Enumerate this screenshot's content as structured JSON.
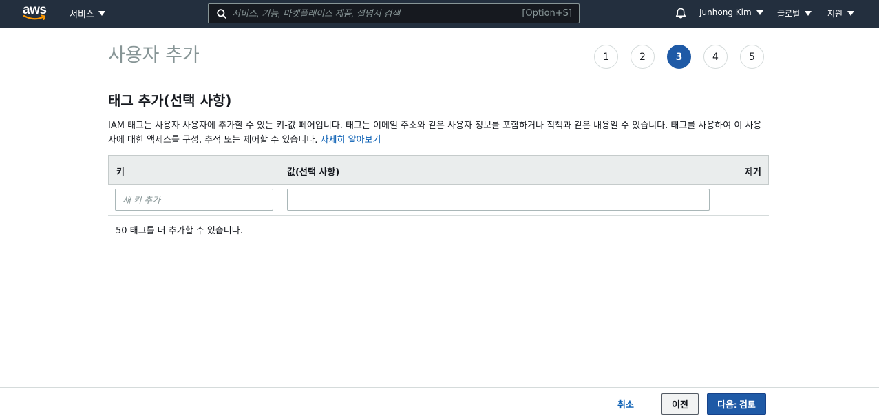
{
  "nav": {
    "logo_text": "aws",
    "services_label": "서비스",
    "search_placeholder": "서비스, 기능, 마켓플레이스 제품, 설명서 검색",
    "search_shortcut": "[Option+S]",
    "user_label": "Junhong Kim",
    "region_label": "글로벌",
    "support_label": "지원"
  },
  "page": {
    "title": "사용자 추가",
    "steps": [
      "1",
      "2",
      "3",
      "4",
      "5"
    ],
    "active_step": "3"
  },
  "tags": {
    "section_title": "태그 추가(선택 사항)",
    "description": "IAM 태그는 사용자 사용자에 추가할 수 있는 키-값 페어입니다. 태그는 이메일 주소와 같은 사용자 정보를 포함하거나 직책과 같은 내용일 수 있습니다. 태그를 사용하여 이 사용자에 대한 액세스를 구성, 추적 또는 제어할 수 있습니다.",
    "learn_more": "자세히 알아보기",
    "col_key": "키",
    "col_value": "값(선택 사항)",
    "col_remove": "제거",
    "key_placeholder": "새 키 추가",
    "key_value": "",
    "value_value": "",
    "remaining_text": "50 태그를 더 추가할 수 있습니다."
  },
  "footer": {
    "cancel_label": "취소",
    "prev_label": "이전",
    "next_label": "다음: 검토"
  },
  "colors": {
    "nav_bg": "#232f3e",
    "primary": "#1f5aa6",
    "link": "#0a5fb4"
  }
}
